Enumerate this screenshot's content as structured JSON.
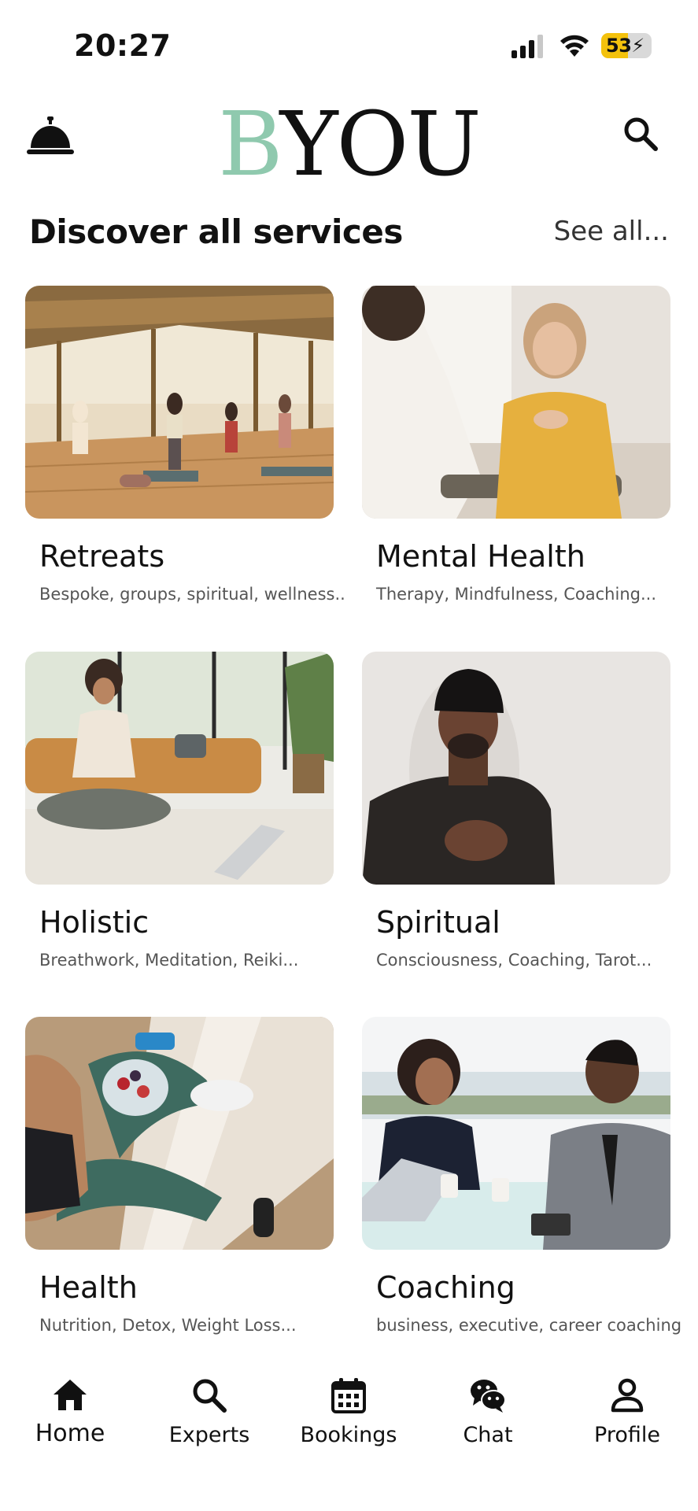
{
  "status_bar": {
    "time": "20:27",
    "battery": "53",
    "battery_level": 0.53
  },
  "header": {
    "logo_first": "B",
    "logo_rest": "YOU"
  },
  "section": {
    "title": "Discover all services",
    "see_all": "See all..."
  },
  "services": [
    {
      "title": "Retreats",
      "subtitle": "Bespoke, groups, spiritual, wellness.."
    },
    {
      "title": "Mental Health",
      "subtitle": "Therapy, Mindfulness, Coaching..."
    },
    {
      "title": "Holistic",
      "subtitle": "Breathwork, Meditation, Reiki..."
    },
    {
      "title": "Spiritual",
      "subtitle": "Consciousness, Coaching, Tarot..."
    },
    {
      "title": "Health",
      "subtitle": "Nutrition, Detox, Weight Loss..."
    },
    {
      "title": "Coaching",
      "subtitle": "business, executive, career coaching"
    }
  ],
  "nav": {
    "items": [
      {
        "label": "Home",
        "icon": "home-icon",
        "active": true
      },
      {
        "label": "Experts",
        "icon": "search-icon"
      },
      {
        "label": "Bookings",
        "icon": "calendar-icon"
      },
      {
        "label": "Chat",
        "icon": "chat-icon"
      },
      {
        "label": "Profile",
        "icon": "profile-icon"
      }
    ]
  }
}
